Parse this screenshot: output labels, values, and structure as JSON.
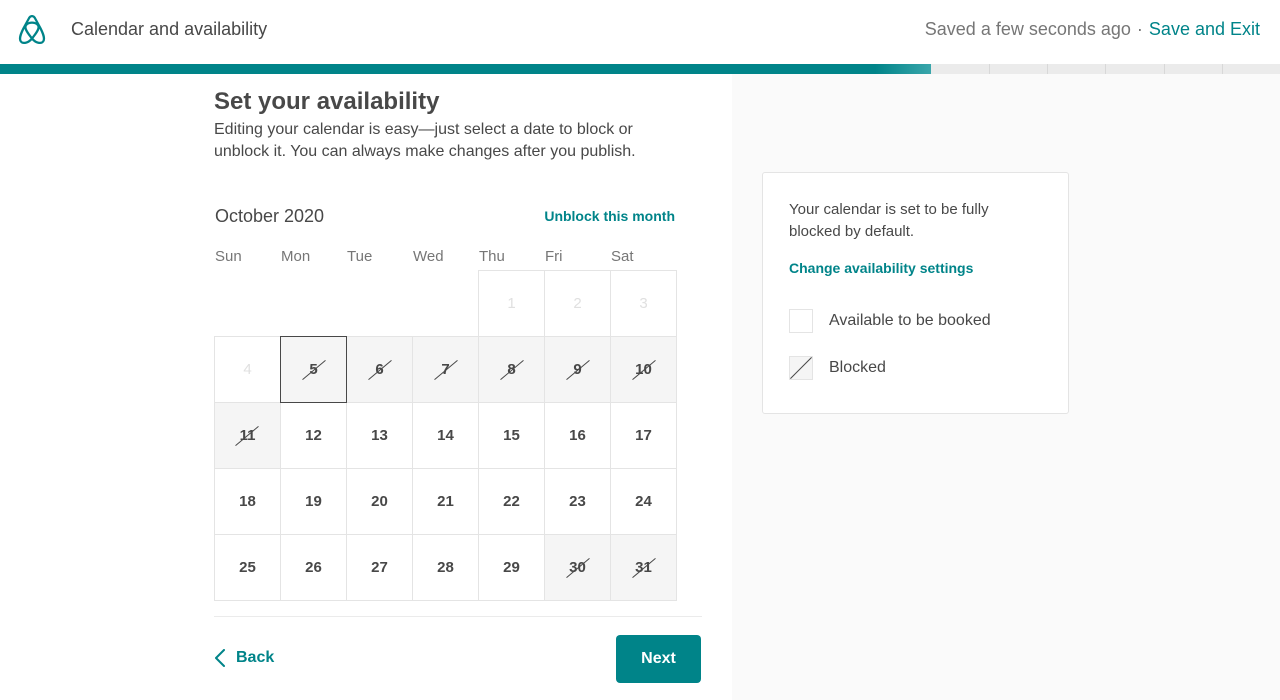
{
  "header": {
    "title": "Calendar and availability",
    "saved_status": "Saved a few seconds ago",
    "separator": "·",
    "save_exit_label": "Save and Exit",
    "logo_icon": "airbnb-logo-icon"
  },
  "progress": {
    "fraction_complete": 0.727,
    "segments_remaining": 6
  },
  "main": {
    "title": "Set your availability",
    "description": "Editing your calendar is easy—just select a date to block or unblock it. You can always make changes after you publish.",
    "calendar": {
      "month_label": "October 2020",
      "unblock_link": "Unblock this month",
      "weekdays": [
        "Sun",
        "Mon",
        "Tue",
        "Wed",
        "Thu",
        "Fri",
        "Sat"
      ],
      "first_weekday_index": 4,
      "days": [
        {
          "day": "1",
          "state": "past"
        },
        {
          "day": "2",
          "state": "past"
        },
        {
          "day": "3",
          "state": "past"
        },
        {
          "day": "4",
          "state": "past"
        },
        {
          "day": "5",
          "state": "blocked",
          "selected": true
        },
        {
          "day": "6",
          "state": "blocked"
        },
        {
          "day": "7",
          "state": "blocked"
        },
        {
          "day": "8",
          "state": "blocked"
        },
        {
          "day": "9",
          "state": "blocked"
        },
        {
          "day": "10",
          "state": "blocked"
        },
        {
          "day": "11",
          "state": "blocked"
        },
        {
          "day": "12",
          "state": "available"
        },
        {
          "day": "13",
          "state": "available"
        },
        {
          "day": "14",
          "state": "available"
        },
        {
          "day": "15",
          "state": "available"
        },
        {
          "day": "16",
          "state": "available"
        },
        {
          "day": "17",
          "state": "available"
        },
        {
          "day": "18",
          "state": "available"
        },
        {
          "day": "19",
          "state": "available"
        },
        {
          "day": "20",
          "state": "available"
        },
        {
          "day": "21",
          "state": "available"
        },
        {
          "day": "22",
          "state": "available"
        },
        {
          "day": "23",
          "state": "available"
        },
        {
          "day": "24",
          "state": "available"
        },
        {
          "day": "25",
          "state": "available"
        },
        {
          "day": "26",
          "state": "available"
        },
        {
          "day": "27",
          "state": "available"
        },
        {
          "day": "28",
          "state": "available"
        },
        {
          "day": "29",
          "state": "available"
        },
        {
          "day": "30",
          "state": "blocked"
        },
        {
          "day": "31",
          "state": "blocked"
        }
      ]
    }
  },
  "footer": {
    "back_label": "Back",
    "next_label": "Next"
  },
  "info_card": {
    "text": "Your calendar is set to be fully blocked by default.",
    "link": "Change availability settings",
    "legend": [
      {
        "label": "Available to be booked",
        "type": "available"
      },
      {
        "label": "Blocked",
        "type": "blocked"
      }
    ]
  },
  "colors": {
    "accent": "#008489",
    "text": "#484848",
    "muted": "#767676",
    "blocked_bg": "#f5f5f5",
    "panel_bg": "#fafafa"
  }
}
